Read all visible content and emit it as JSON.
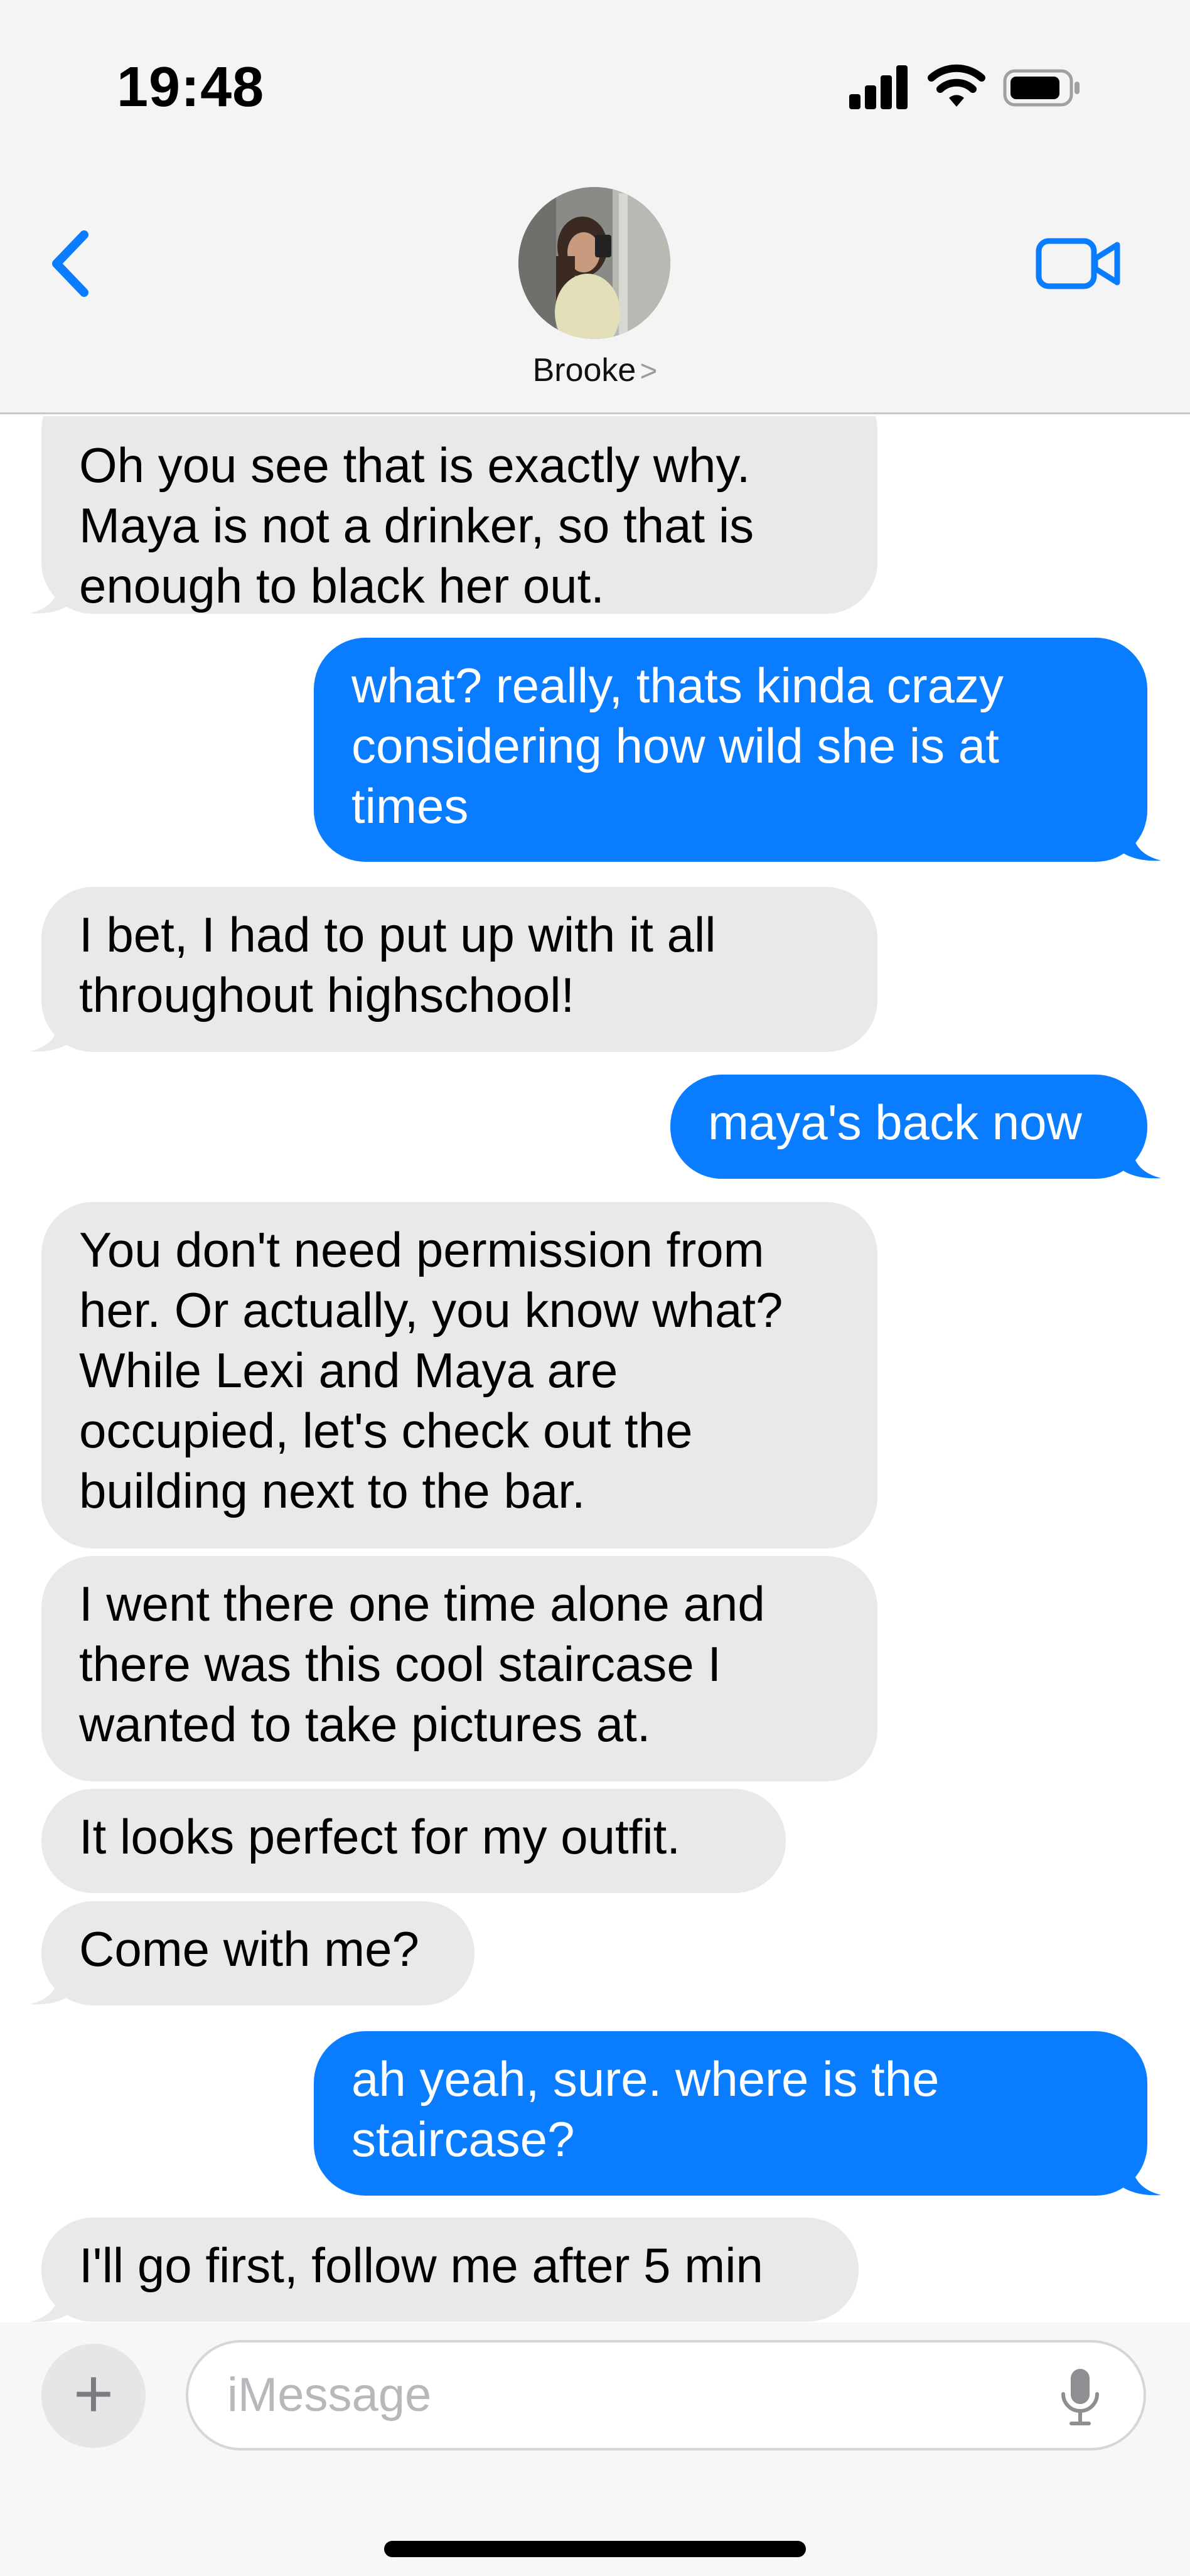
{
  "status_bar": {
    "time": "19:48"
  },
  "header": {
    "contact_name": "Brooke",
    "name_chevron": ">",
    "back_icon": "chevron-left-icon",
    "video_icon": "video-camera-icon",
    "accent_color": "#0a7cff"
  },
  "messages": [
    {
      "from": "contact",
      "text": "Oh you see that is exactly why.\nMaya is not a drinker, so that is\nenough to black her out."
    },
    {
      "from": "me",
      "text": "what? really, thats kinda crazy\nconsidering how wild she is at\ntimes"
    },
    {
      "from": "contact",
      "text": "I bet, I had to put up with it all\nthroughout highschool!"
    },
    {
      "from": "me",
      "text": "maya's back now"
    },
    {
      "from": "contact",
      "text": "You don't need permission from\nher. Or actually, you know what?\nWhile Lexi and Maya are\noccupied, let's check out the\nbuilding next to the bar."
    },
    {
      "from": "contact",
      "text": "I went there one time alone and\nthere was this cool staircase I\nwanted to take pictures at."
    },
    {
      "from": "contact",
      "text": "It looks perfect for my outfit."
    },
    {
      "from": "contact",
      "text": "Come with me?"
    },
    {
      "from": "me",
      "text": "ah yeah, sure. where is the\nstaircase?"
    },
    {
      "from": "contact",
      "text": "I'll go first, follow me after 5 min"
    }
  ],
  "composer": {
    "plus_label": "+",
    "placeholder": "iMessage",
    "mic_icon": "microphone-icon"
  }
}
